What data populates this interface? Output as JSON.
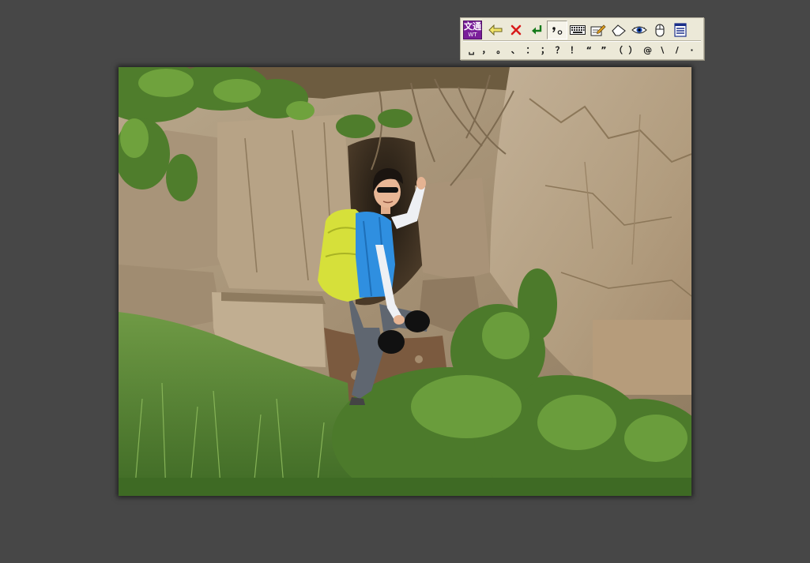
{
  "ime_toolbar": {
    "logo": {
      "top_text": "文通",
      "bottom_text": "WT",
      "color": "#7a1f9a"
    },
    "buttons": [
      {
        "icon": "arrow-left-icon"
      },
      {
        "icon": "close-x-icon"
      },
      {
        "icon": "enter-return-icon"
      },
      {
        "icon": "punctuation-mode-icon",
        "pressed": true
      },
      {
        "icon": "keyboard-icon"
      },
      {
        "icon": "edit-note-icon"
      },
      {
        "icon": "eraser-icon"
      },
      {
        "icon": "eye-icon"
      },
      {
        "icon": "mouse-icon"
      },
      {
        "icon": "menu-list-icon"
      }
    ],
    "punctuation": [
      "␣",
      "，",
      "。",
      "、",
      "：",
      "；",
      "？",
      "！",
      "“",
      "”",
      "（",
      "）",
      "@",
      "\\",
      "/",
      "·"
    ]
  },
  "photo": {
    "subject": "hiker-in-rock-crevice",
    "colors": {
      "rock": "#a8957a",
      "foliage": "#4e7a2e",
      "shirt": "#2f8fe0",
      "backpack": "#d6e03a"
    }
  }
}
